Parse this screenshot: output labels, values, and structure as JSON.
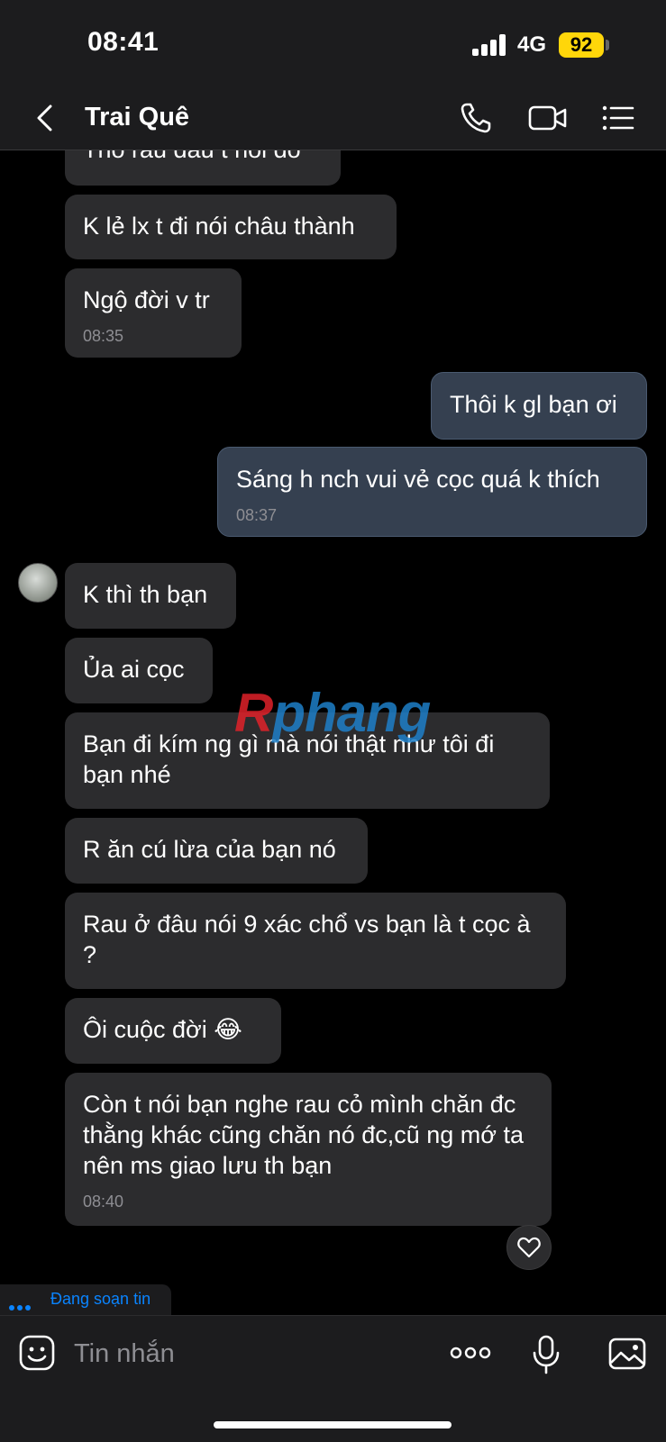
{
  "status_bar": {
    "time": "08:41",
    "network": "4G",
    "battery": "92"
  },
  "header": {
    "contact_name": "Trai Quê",
    "icons": [
      "back-icon",
      "phone-icon",
      "video-camera-icon",
      "list-menu-icon"
    ]
  },
  "messages": [
    {
      "text": "Thô rau đâu t nói đó",
      "direction": "in"
    },
    {
      "text": "K lẻ lx t đi nói châu thành",
      "direction": "in"
    },
    {
      "text": "Ngộ đời v tr",
      "direction": "in",
      "time": "08:35"
    },
    {
      "text": "Thôi k gl bạn ơi",
      "direction": "out"
    },
    {
      "text": "Sáng h nch vui vẻ cọc quá k thích",
      "direction": "out",
      "time": "08:37"
    },
    {
      "text": "K thì th bạn",
      "direction": "in"
    },
    {
      "text": "Ủa ai cọc",
      "direction": "in"
    },
    {
      "text": "Bạn đi kím ng gì mà nói thật như tôi đi bạn nhé",
      "direction": "in"
    },
    {
      "text": "R ăn cú lừa của bạn nó",
      "direction": "in"
    },
    {
      "text": "Rau ở đâu nói 9 xác chổ vs bạn là t cọc à ?",
      "direction": "in"
    },
    {
      "text": "Ôi cuộc đời 😂",
      "direction": "in"
    },
    {
      "text": "Còn t nói bạn nghe rau cỏ mình chăn đc thằng khác cũng chăn nó đc,cũ ng mớ ta nên ms giao lưu th bạn",
      "direction": "in",
      "time": "08:40"
    }
  ],
  "watermark": {
    "first": "R",
    "rest": "phang"
  },
  "typing_indicator": "Đang soạn tin",
  "composer": {
    "placeholder": "Tin nhắn",
    "icons": [
      "sticker-icon",
      "more-options-icon",
      "microphone-icon",
      "image-icon"
    ]
  },
  "colors": {
    "background": "#000000",
    "bar": "#1c1c1e",
    "incoming_bubble": "#2c2c2e",
    "outgoing_bubble": "#354050",
    "accent": "#0a84ff",
    "battery": "#ffd60a"
  }
}
